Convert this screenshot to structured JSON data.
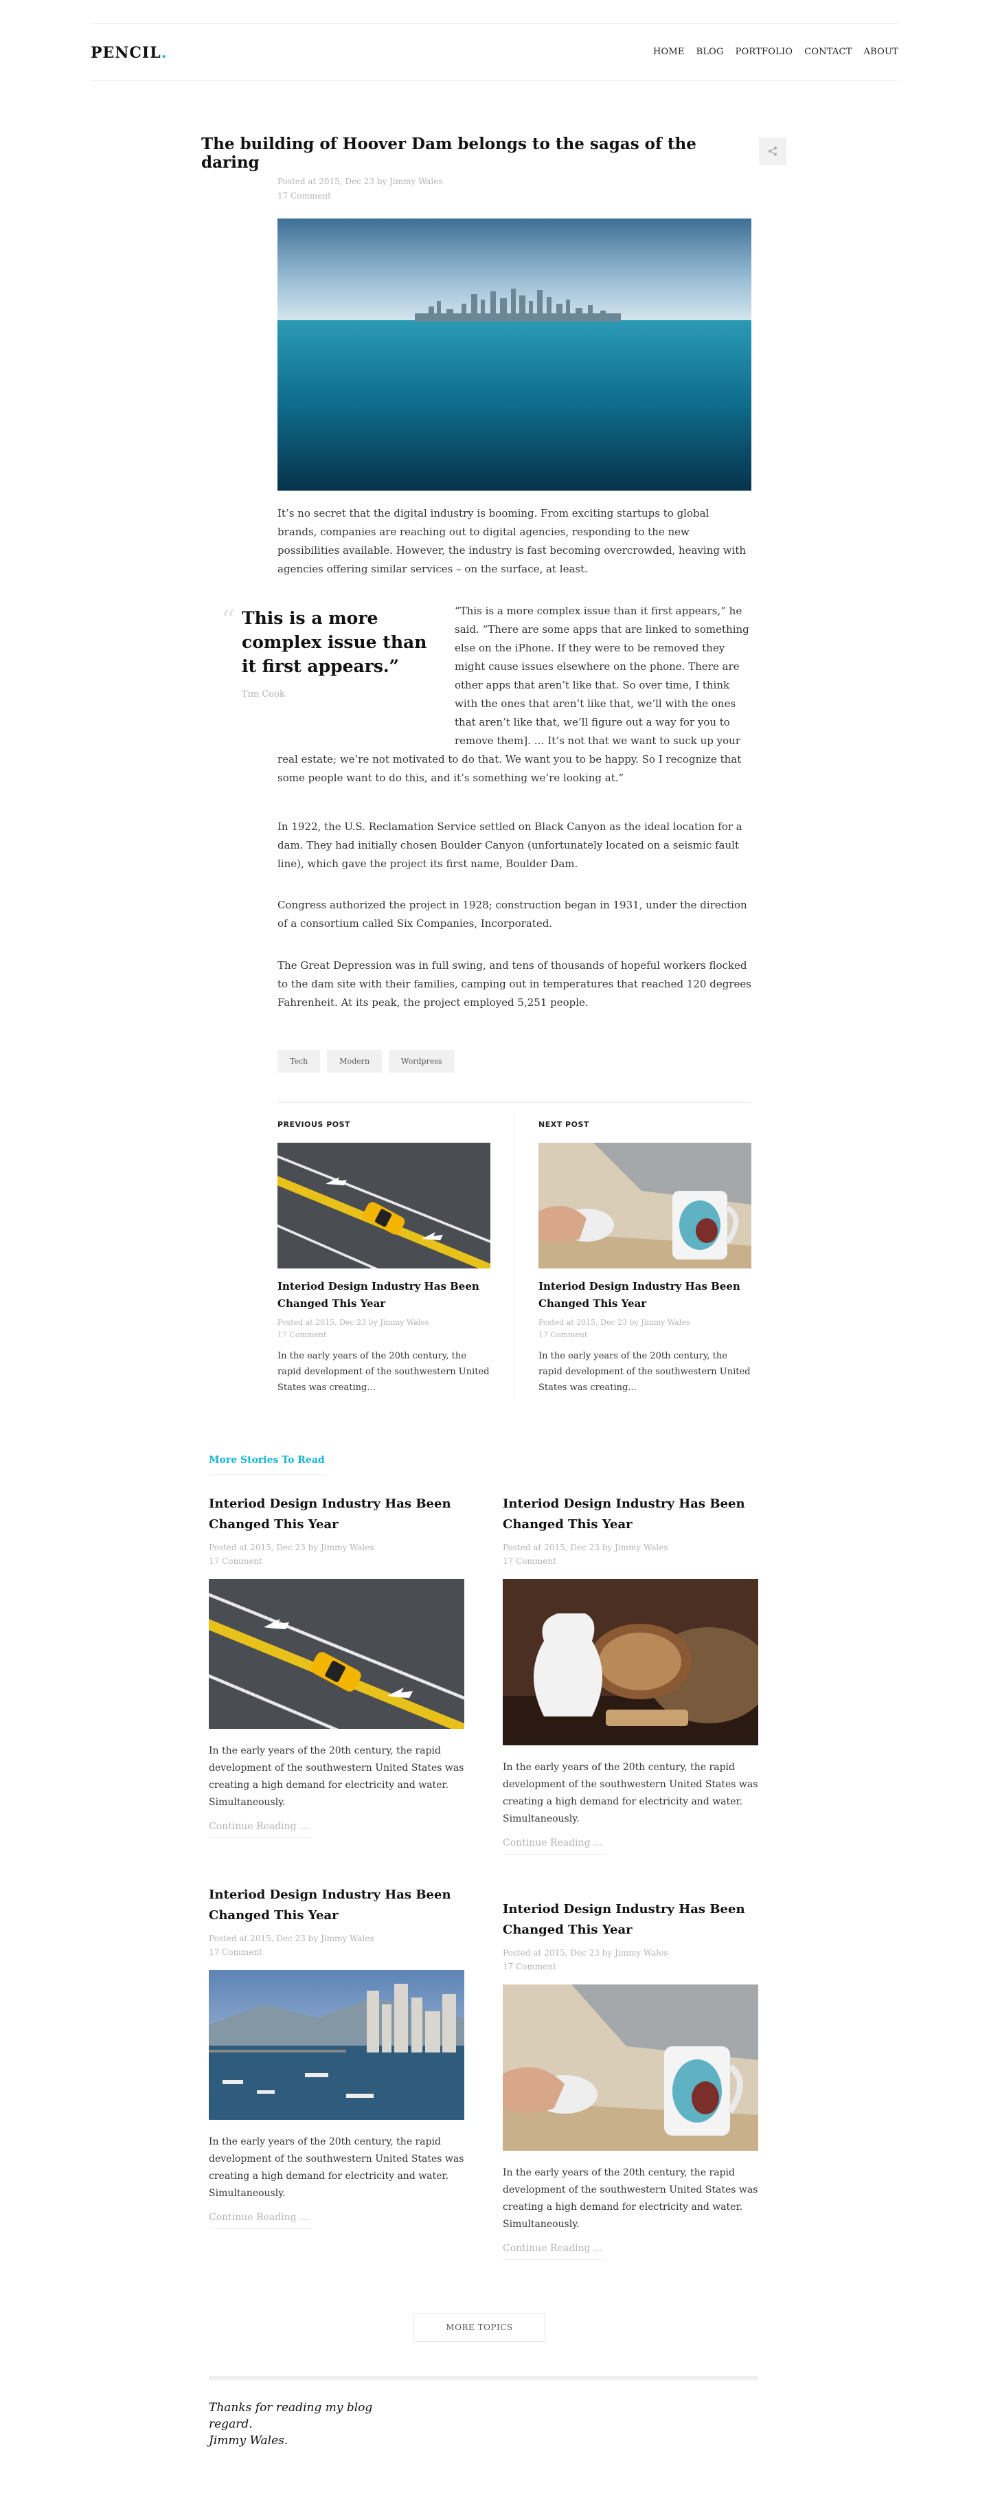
{
  "header": {
    "logo": "PENCIL",
    "logo_dot": ".",
    "nav": [
      "HOME",
      "BLOG",
      "PORTFOLIO",
      "CONTACT",
      "ABOUT"
    ]
  },
  "article": {
    "title": "The building of Hoover Dam belongs to the sagas of the daring",
    "meta_line1": "Posted at 2015, Dec 23 by Jimmy Wales",
    "meta_line2": "17 Comment",
    "para1": "It’s no secret that the digital industry is booming. From exciting startups to global brands, companies are reaching out to digital agencies, responding to the new possibilities available. However, the industry is fast becoming overcrowded, heaving with agencies offering similar services – on the surface, at least.",
    "pullquote": "This is a more complex issue than it first appears.”",
    "pullquote_author": "Tim Cook",
    "quote_para": "“This is a more complex issue than it first appears,” he said. “There are some apps that are linked to something else on the iPhone. If they were to be removed they might cause issues elsewhere on the phone. There are other apps that aren’t like that. So over time, I think with the ones that aren’t like that, we’ll with the ones that aren’t like that, we’ll figure out a way for you to remove them]. … It’s not that we want to suck up your real estate; we’re not motivated to do that. We want you to be happy. So I recognize that some people want to do this, and it’s something we’re looking at.”",
    "para2": "In 1922, the U.S. Reclamation Service settled on Black Canyon as the ideal location for a dam. They had initially chosen Boulder Canyon (unfortunately located on a seismic fault line), which gave the project its first name, Boulder Dam.",
    "para3": "Congress authorized the project in 1928; construction began in 1931, under the direction of a consortium called Six Companies, Incorporated.",
    "para4": "The Great Depression was in full swing, and tens of thousands of hopeful workers flocked to the dam site with their families, camping out in temperatures that reached 120 degrees Fahrenheit. At its peak, the project employed 5,251 people.",
    "tags": [
      "Tech",
      "Modern",
      "Wordpress"
    ]
  },
  "postnav": {
    "prev": {
      "label": "PREVIOUS POST",
      "title": "Interiod Design Industry Has Been Changed This Year",
      "meta1": "Posted at 2015, Dec 23 by Jimmy Wales",
      "meta2": "17 Comment",
      "excerpt": "In the early years of the 20th century, the rapid development of the southwestern United States was creating..."
    },
    "next": {
      "label": "NEXT POST",
      "title": "Interiod Design Industry Has Been Changed This Year",
      "meta1": "Posted at 2015, Dec 23 by Jimmy Wales",
      "meta2": "17 Comment",
      "excerpt": "In the early years of the 20th century, the rapid development of the southwestern United States was creating..."
    }
  },
  "more": {
    "heading": "More Stories To Read",
    "cards": [
      {
        "title": "Interiod Design Industry Has Been Changed This Year",
        "meta1": "Posted at 2015, Dec 23 by Jimmy Wales",
        "meta2": "17 Comment",
        "text": "In the early years of the 20th century, the rapid development of the southwestern United States was creating a high demand for electricity and water. Simultaneously.",
        "link": "Continue Reading ..."
      },
      {
        "title": "Interiod Design Industry Has Been Changed This Year",
        "meta1": "Posted at 2015, Dec 23 by Jimmy Wales",
        "meta2": "17 Comment",
        "text": "In the early years of the 20th century, the rapid development of the southwestern United States was creating a high demand for electricity and water. Simultaneously.",
        "link": "Continue Reading ..."
      },
      {
        "title": "Interiod Design Industry Has Been Changed This Year",
        "meta1": "Posted at 2015, Dec 23 by Jimmy Wales",
        "meta2": "17 Comment",
        "text": "In the early years of the 20th century, the rapid development of the southwestern United States was creating a high demand for electricity and water. Simultaneously.",
        "link": "Continue Reading ..."
      },
      {
        "title": "Interiod Design Industry Has Been Changed This Year",
        "meta1": "Posted at 2015, Dec 23 by Jimmy Wales",
        "meta2": "17 Comment",
        "text": "In the early years of the 20th century, the rapid development of the southwestern United States was creating a high demand for electricity and water. Simultaneously.",
        "link": "Continue Reading ..."
      }
    ]
  },
  "more_topics": "MORE TOPICS",
  "signoff": [
    "Thanks for reading my blog",
    "regard.",
    "Jimmy Wales."
  ],
  "colors": {
    "accent": "#16b7d6",
    "muted": "#b4b4b4",
    "text": "#333333"
  }
}
